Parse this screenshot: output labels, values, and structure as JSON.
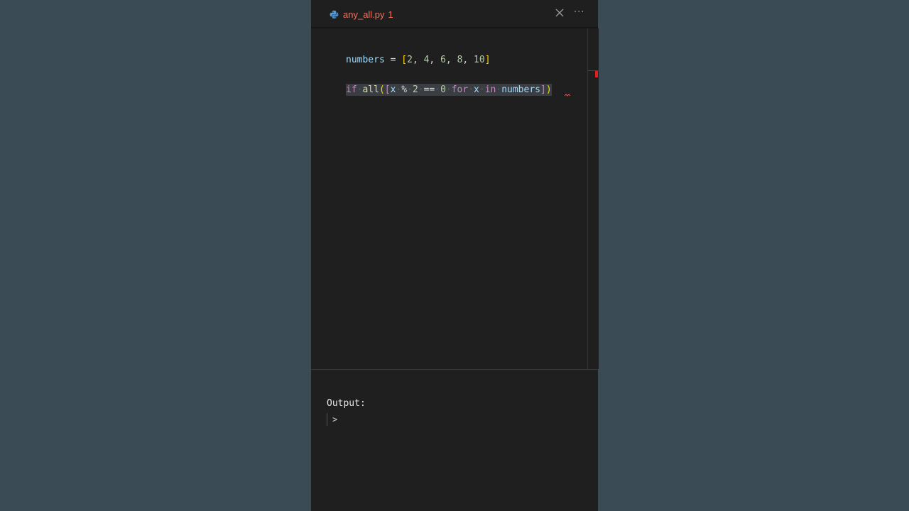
{
  "tab": {
    "filename": "any_all.py",
    "problem_count": "1",
    "icon": "python-icon"
  },
  "toolbar": {
    "close_icon": "close-icon",
    "more_icon": "more-actions-icon",
    "more_glyph": "···"
  },
  "editor": {
    "line1": {
      "var": "numbers",
      "eq": " = ",
      "open": "[",
      "items": [
        "2",
        "4",
        "6",
        "8",
        "10"
      ],
      "close": "]"
    },
    "line2": {
      "kw_if": "if",
      "fn": "all",
      "open_paren": "(",
      "open_bracket": "[",
      "x1": "x",
      "mod": "%",
      "two": "2",
      "eqeq": "==",
      "zero": "0",
      "kw_for": "for",
      "x2": "x",
      "kw_in": "in",
      "iter": "numbers",
      "close_bracket": "]",
      "close_paren": ")"
    }
  },
  "output": {
    "label": "Output:",
    "prompt": ">"
  },
  "colors": {
    "background": "#3b4b55",
    "panel": "#1f1f1f",
    "tab_error": "#f0745f",
    "error_marker": "#e31e1e"
  }
}
